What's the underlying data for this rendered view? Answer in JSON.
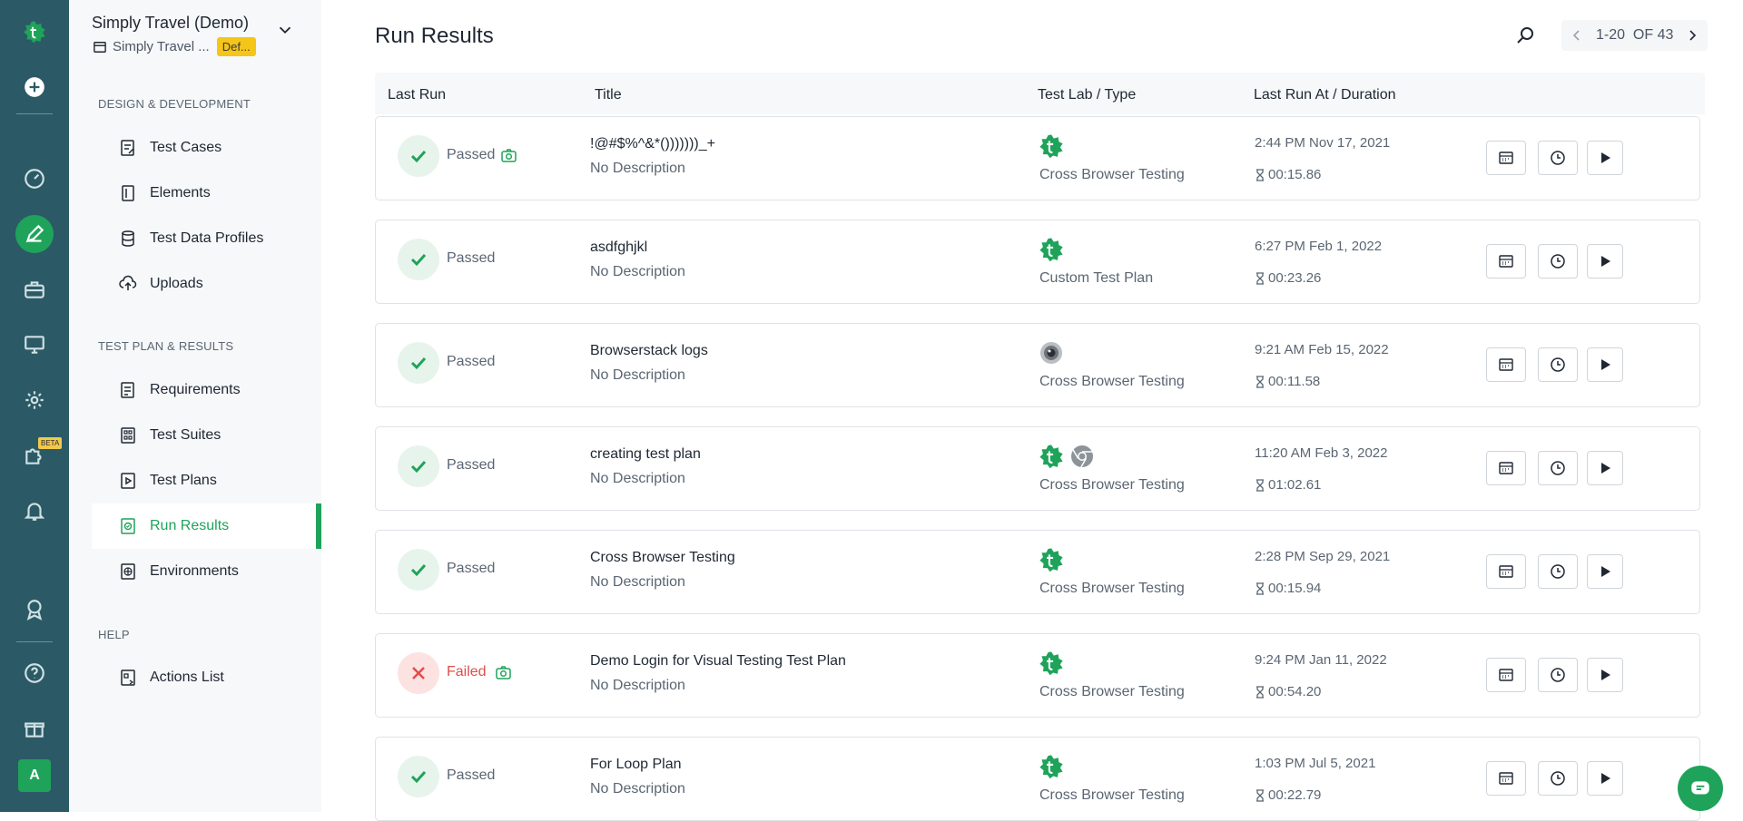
{
  "workspace": {
    "name": "Simply Travel (Demo)",
    "app": "Simply Travel ...",
    "badge": "Def..."
  },
  "rail": {
    "beta_label": "BETA",
    "avatar_initial": "A"
  },
  "nav": {
    "sections": [
      {
        "title": "DESIGN & DEVELOPMENT",
        "items": [
          "Test Cases",
          "Elements",
          "Test Data Profiles",
          "Uploads"
        ]
      },
      {
        "title": "TEST PLAN & RESULTS",
        "items": [
          "Requirements",
          "Test Suites",
          "Test Plans",
          "Run Results",
          "Environments"
        ]
      },
      {
        "title": "HELP",
        "items": [
          "Actions List"
        ]
      }
    ],
    "active": "Run Results"
  },
  "page": {
    "title": "Run Results"
  },
  "pager": {
    "range": "1-20",
    "of_label": "OF",
    "total": "43"
  },
  "table": {
    "headers": [
      "Last Run",
      "Title",
      "Test Lab / Type",
      "Last Run At / Duration"
    ],
    "rows": [
      {
        "status": "Passed",
        "title": "!@#$%^&*()))))))_+",
        "desc": "No Description",
        "type": "Cross Browser Testing",
        "run_at": "2:44 PM Nov 17, 2021",
        "duration": "00:15.86"
      },
      {
        "status": "Passed",
        "title": "asdfghjkl",
        "desc": "No Description",
        "type": "Custom Test Plan",
        "run_at": "6:27 PM Feb 1, 2022",
        "duration": "00:23.26"
      },
      {
        "status": "Passed",
        "title": "Browserstack logs",
        "desc": "No Description",
        "type": "Cross Browser Testing",
        "run_at": "9:21 AM Feb 15, 2022",
        "duration": "00:11.58"
      },
      {
        "status": "Passed",
        "title": "creating test plan",
        "desc": "No Description",
        "type": "Cross Browser Testing",
        "run_at": "11:20 AM Feb 3, 2022",
        "duration": "01:02.61"
      },
      {
        "status": "Passed",
        "title": "Cross Browser Testing",
        "desc": "No Description",
        "type": "Cross Browser Testing",
        "run_at": "2:28 PM Sep 29, 2021",
        "duration": "00:15.94"
      },
      {
        "status": "Failed",
        "title": "Demo Login for Visual Testing Test Plan",
        "desc": "No Description",
        "type": "Cross Browser Testing",
        "run_at": "9:24 PM Jan 11, 2022",
        "duration": "00:54.20"
      },
      {
        "status": "Passed",
        "title": "For Loop Plan",
        "desc": "No Description",
        "type": "Cross Browser Testing",
        "run_at": "1:03 PM Jul 5, 2021",
        "duration": "00:22.79"
      }
    ]
  },
  "colors": {
    "rail": "#2b5a66",
    "accent": "#1fa35a",
    "fail": "#e24c4c",
    "badge": "#f5c518"
  }
}
